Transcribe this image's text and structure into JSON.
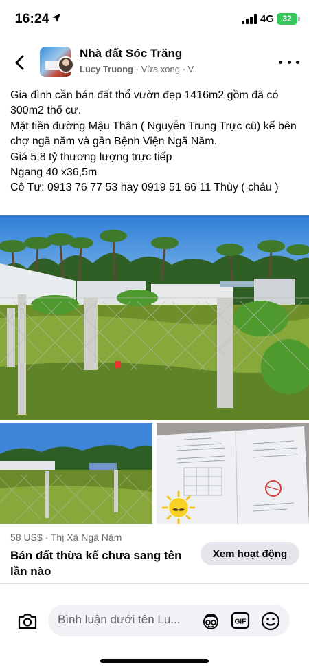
{
  "status_bar": {
    "time": "16:24",
    "network": "4G",
    "battery": "32"
  },
  "header": {
    "group_name": "Nhà đất Sóc Trăng",
    "author": "Lucy Truong",
    "timestamp": "· Vừa xong · V"
  },
  "post": {
    "lines": [
      "Gia đình cần bán đất thổ vườn đẹp 1416m2 gồm đã có 300m2 thổ cư.",
      "Mặt tiền đường Mậu Thân ( Nguyễn Trung Trực cũ) kế bên chợ ngã năm và gần Bệnh Viện Ngã Năm.",
      "Giá 5,8 tỷ thương lượng trực tiếp",
      "Ngang 40 x36,5m",
      "Cô Tư: 0913 76 77 53 hay 0919 51 66 11 Thùy ( cháu )"
    ]
  },
  "listing": {
    "price_location": "58 US$ · Thị Xã Ngã Năm",
    "title": "Bán đất thừa kế chưa sang tên lần nào",
    "action_label": "Xem hoạt động"
  },
  "comment": {
    "placeholder": "Bình luận dưới tên Lu..."
  },
  "icons": {
    "back": "chevron-left-icon",
    "more": "more-horizontal-icon",
    "camera": "camera-icon",
    "avatar": "avatar-sticker-icon",
    "gif": "gif-icon",
    "emoji": "emoji-icon"
  }
}
